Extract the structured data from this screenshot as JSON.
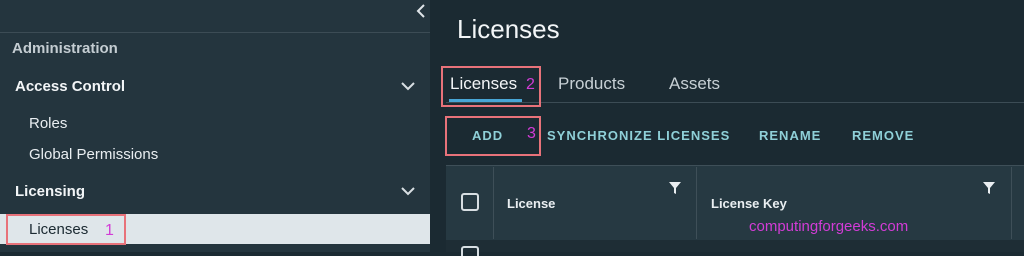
{
  "sidebar": {
    "section_title": "Administration",
    "groups": [
      {
        "label": "Access Control",
        "items": [
          "Roles",
          "Global Permissions"
        ]
      },
      {
        "label": "Licensing",
        "items": [
          "Licenses"
        ]
      }
    ]
  },
  "main": {
    "page_title": "Licenses",
    "tabs": [
      "Licenses",
      "Products",
      "Assets"
    ],
    "active_tab": "Licenses",
    "actions": [
      "ADD",
      "SYNCHRONIZE LICENSES",
      "RENAME",
      "REMOVE"
    ],
    "grid": {
      "columns": [
        "License",
        "License Key"
      ]
    }
  },
  "annotations": [
    "1",
    "2",
    "3"
  ],
  "watermark": "computingforgeeks.com",
  "colors": {
    "sidebar_bg": "#24353e",
    "main_bg": "#1b2a32",
    "active_item_bg": "#dfe6ea",
    "action_text": "#8fd0d8",
    "tab_underline": "#48a6d6",
    "annotation_box": "#e8727a",
    "annotation_number": "#d23cd6"
  }
}
